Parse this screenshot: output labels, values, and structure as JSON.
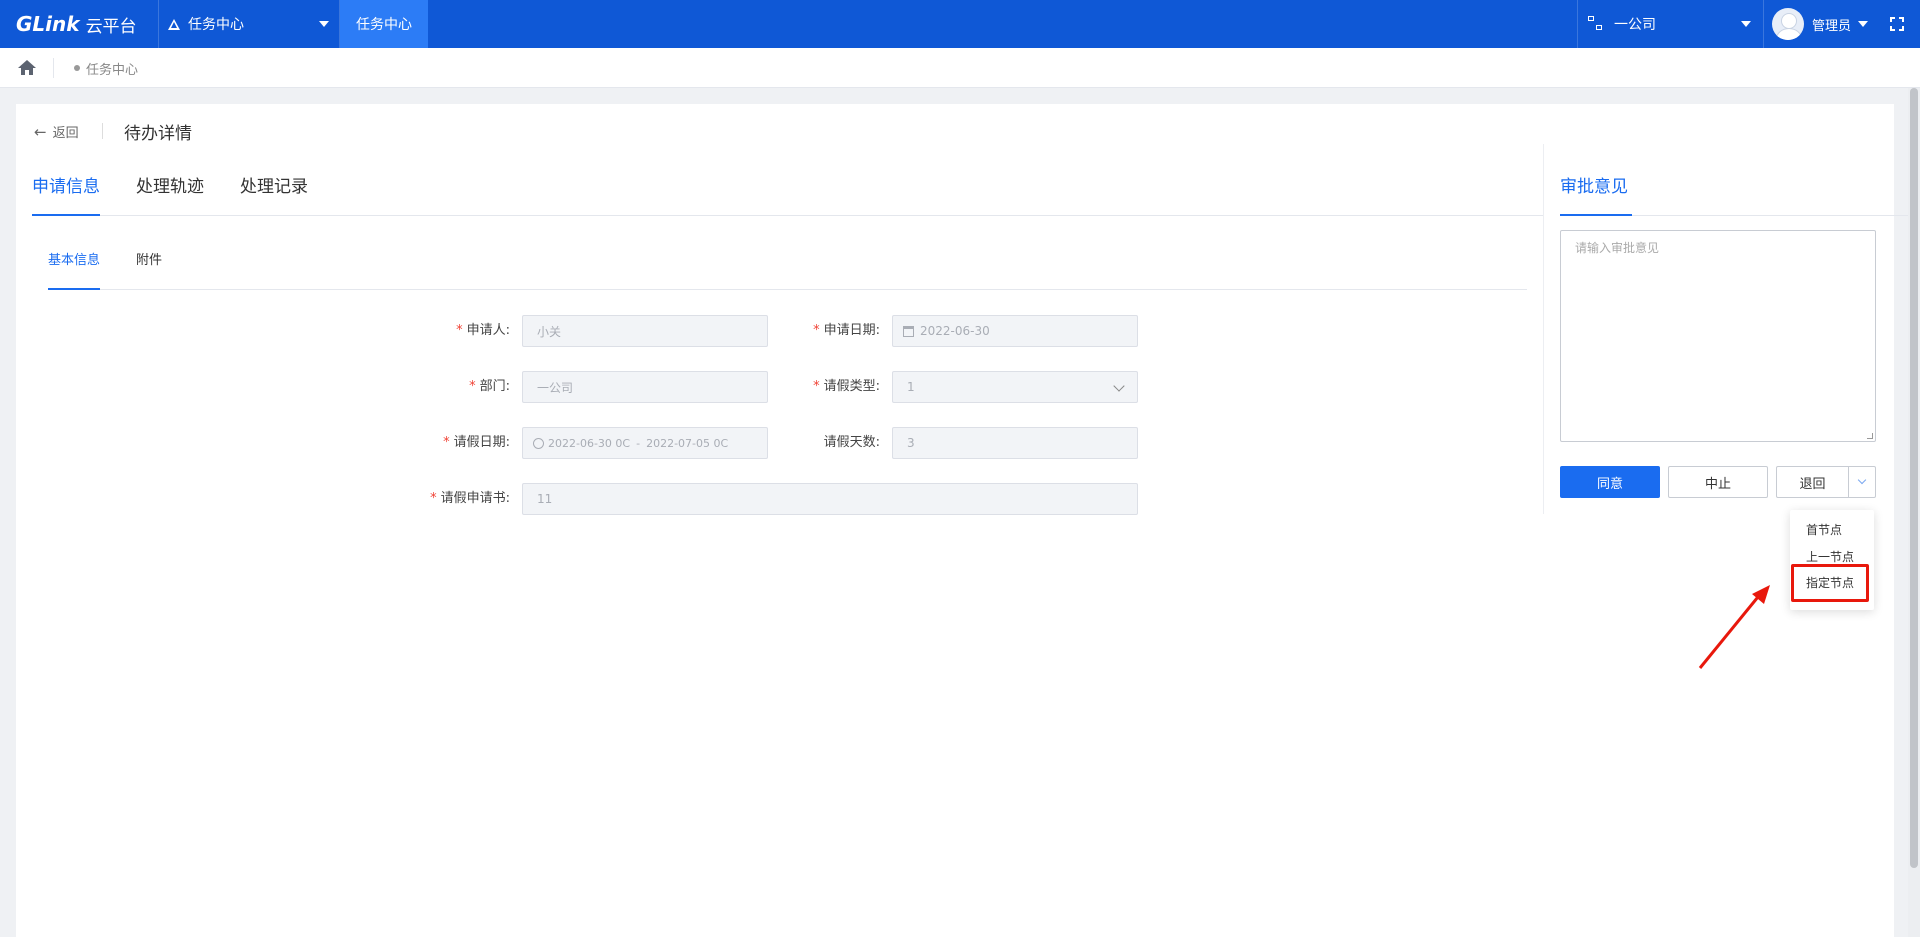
{
  "topbar": {
    "logo_mark": "GLink",
    "logo_text": "云平台",
    "module_label": "任务中心",
    "active_tab_label": "任务中心",
    "company_label": "一公司",
    "user_label": "管理员",
    "brand_color": "#0f58d6"
  },
  "breadcrumb": {
    "home_icon": "home-icon",
    "current": "任务中心"
  },
  "page": {
    "back_label": "返回",
    "title": "待办详情"
  },
  "main_tabs": [
    {
      "label": "申请信息",
      "active": true
    },
    {
      "label": "处理轨迹",
      "active": false
    },
    {
      "label": "处理记录",
      "active": false
    }
  ],
  "sub_tabs": [
    {
      "label": "基本信息",
      "active": true
    },
    {
      "label": "附件",
      "active": false
    }
  ],
  "form": {
    "applicant": {
      "label": "申请人:",
      "value": "小关",
      "required": true
    },
    "apply_date": {
      "label": "申请日期:",
      "value": "2022-06-30",
      "required": true
    },
    "department": {
      "label": "部门:",
      "value": "一公司",
      "required": true
    },
    "leave_type": {
      "label": "请假类型:",
      "value": "1",
      "required": true
    },
    "leave_date": {
      "label": "请假日期:",
      "start": "2022-06-30 0C",
      "separator": "-",
      "end": "2022-07-05 0C",
      "required": true
    },
    "leave_days": {
      "label": "请假天数:",
      "value": "3",
      "required": false
    },
    "leave_letter": {
      "label": "请假申请书:",
      "value": "11",
      "required": true
    }
  },
  "approval": {
    "tab_label": "审批意见",
    "placeholder": "请输入审批意见",
    "agree_label": "同意",
    "stop_label": "中止",
    "return_label": "退回",
    "return_options": [
      "首节点",
      "上一节点",
      "指定节点"
    ],
    "highlighted_option": "指定节点",
    "accent_color": "#1a6cf0",
    "highlight_color": "#e8180c"
  }
}
